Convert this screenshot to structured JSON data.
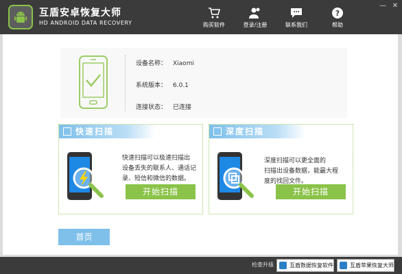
{
  "header": {
    "title": "互盾安卓恢复大师",
    "subtitle": "HD ANDROID DATA RECOVERY",
    "nav": [
      {
        "label": "购买软件",
        "icon": "cart-icon"
      },
      {
        "label": "登录/注册",
        "icon": "users-icon"
      },
      {
        "label": "联系我们",
        "icon": "chat-icon"
      },
      {
        "label": "帮助",
        "icon": "help-icon"
      }
    ],
    "window_controls": {
      "minimize": "—",
      "close": "✕"
    }
  },
  "device": {
    "name_label": "设备名称：",
    "name_value": "Xiaomi",
    "version_label": "系统版本：",
    "version_value": "6.0.1",
    "status_label": "连接状态：",
    "status_value": "已连接"
  },
  "quick_scan": {
    "title": "快速扫描",
    "desc": [
      "快速扫描可以极速扫描出",
      "设备丢失的联系人、通话记",
      "录、短信和微信的数据。"
    ],
    "button": "开始扫描"
  },
  "deep_scan": {
    "title": "深度扫描",
    "desc": [
      "深度扫描可以更全面的",
      "扫描出设备数据，能最大程",
      "度的找回文件。"
    ],
    "button": "开始扫描"
  },
  "home_button": "首页",
  "footer": {
    "update_label": "检查升级",
    "apps": [
      {
        "label": "互盾数据恢复软件",
        "icon": "hd-data-recovery-icon"
      },
      {
        "label": "互盾苹果恢复大师",
        "icon": "hd-apple-recovery-icon"
      }
    ]
  },
  "colors": {
    "titlebar": "#3b3b3b",
    "accent_green": "#8bc34a",
    "accent_blue": "#7ec0ea"
  }
}
